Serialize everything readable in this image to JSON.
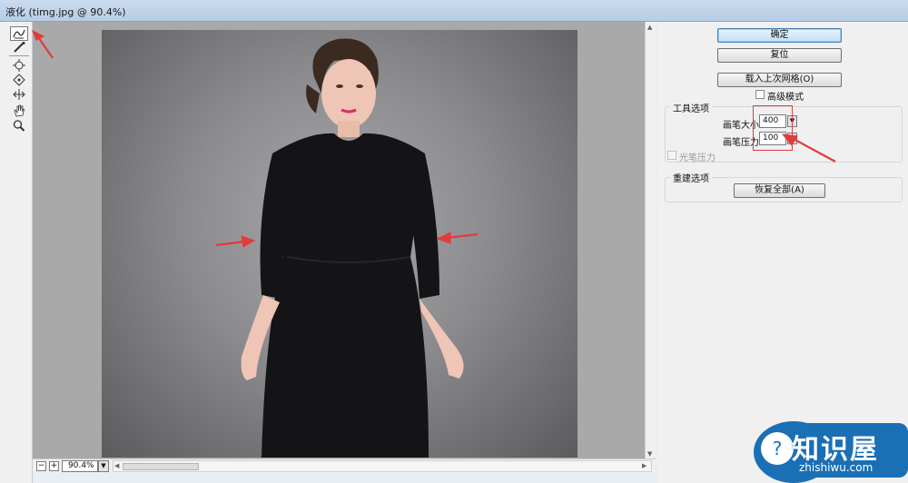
{
  "window": {
    "title": "液化 (timg.jpg @ 90.4%)"
  },
  "tools": [
    {
      "name": "forward-warp-tool"
    },
    {
      "name": "reconstruct-tool"
    },
    {
      "name": "pucker-tool"
    },
    {
      "name": "bloat-tool"
    },
    {
      "name": "push-left-tool"
    },
    {
      "name": "hand-tool"
    },
    {
      "name": "zoom-tool"
    }
  ],
  "zoom": {
    "minus": "−",
    "plus": "+",
    "value": "90.4%",
    "dropdown": "▼"
  },
  "panel": {
    "ok_label": "确定",
    "reset_label": "复位",
    "load_mesh_label": "载入上次网格(O)",
    "advanced_mode_label": "高级模式",
    "tool_options": {
      "legend": "工具选项",
      "brush_size_label": "画笔大小:",
      "brush_size_value": "400",
      "brush_pressure_label": "画笔压力:",
      "brush_pressure_value": "100",
      "stylus_pressure_label": "光笔压力"
    },
    "reconstruct_options": {
      "legend": "重建选项",
      "restore_all_label": "恢复全部(A)"
    }
  },
  "watermark": {
    "brand": "知识屋",
    "domain": "zhishiwu.com"
  },
  "colors": {
    "annotation_red": "#e23b3b",
    "accent_blue": "#3c7fb1",
    "watermark_blue": "#1b6fb5"
  }
}
